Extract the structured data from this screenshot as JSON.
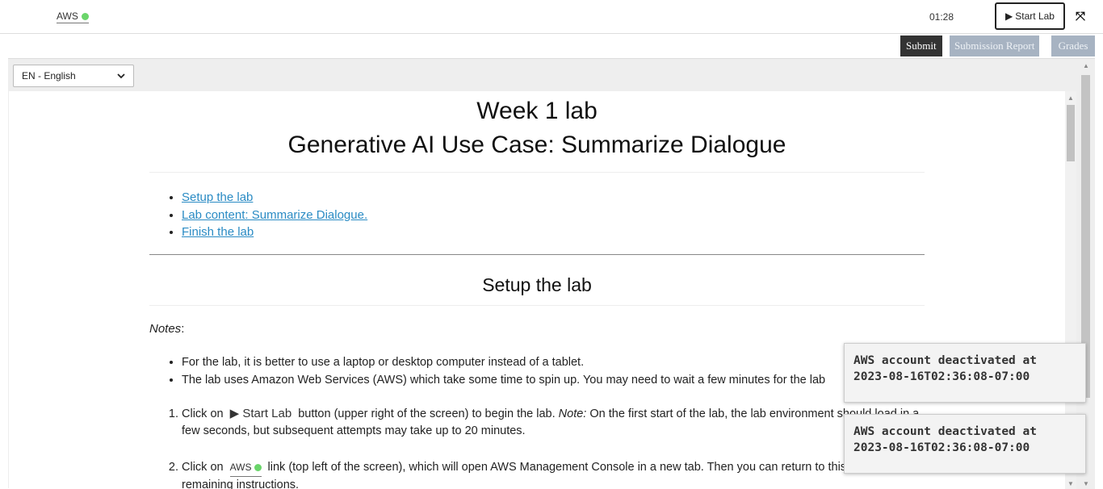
{
  "topbar": {
    "aws_label": "AWS",
    "timer": "01:28",
    "start_lab_label": "Start Lab"
  },
  "actions": {
    "submit": "Submit",
    "submission_report": "Submission Report",
    "grades": "Grades"
  },
  "language": {
    "selected": "EN - English"
  },
  "doc": {
    "title1": "Week 1 lab",
    "title2": "Generative AI Use Case: Summarize Dialogue",
    "toc": [
      "Setup the lab",
      "Lab content: Summarize Dialogue.",
      "Finish the lab"
    ],
    "section_title": "Setup the lab",
    "notes_label": "Notes",
    "notes_colon": ":",
    "bullets": [
      "For the lab, it is better to use a laptop or desktop computer instead of a tablet.",
      "The lab uses Amazon Web Services (AWS) which take some time to spin up. You may need to wait a few minutes for the lab"
    ],
    "step1_pre": "Click on",
    "step1_btn": "Start Lab",
    "step1_post": "button (upper right of the screen) to begin the lab.",
    "step1_note_label": "Note:",
    "step1_note": "On the first start of the lab, the lab environment should load in a few seconds, but subsequent attempts may take up to 20 minutes.",
    "step2_pre": "Click on",
    "step2_aws": "AWS",
    "step2_post": "link (top left of the screen), which will open AWS Management Console in a new tab. Then you can return to this tab to find the remaining instructions."
  },
  "toasts": [
    "AWS account deactivated at 2023-08-16T02:36:08-07:00",
    "AWS account deactivated at 2023-08-16T02:36:08-07:00"
  ],
  "colors": {
    "link": "#2a8bc4",
    "status_dot": "#6ad56a",
    "submit_bg": "#333333",
    "disabled_bg": "#a7b3c2"
  },
  "icons": [
    "play-icon",
    "expand-icon",
    "status-dot-icon",
    "chevron-down-icon"
  ]
}
